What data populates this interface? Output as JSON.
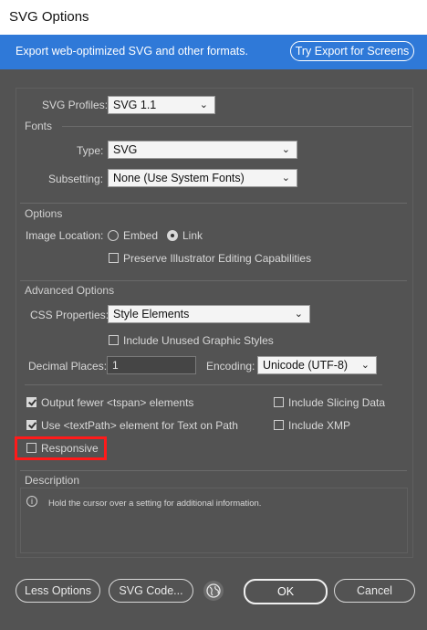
{
  "window": {
    "title": "SVG Options"
  },
  "banner": {
    "message": "Export web-optimized SVG and other formats.",
    "button_label": "Try Export for Screens"
  },
  "svg_profiles": {
    "label": "SVG Profiles:",
    "value": "SVG 1.1"
  },
  "fonts": {
    "section": "Fonts",
    "type_label": "Type:",
    "type_value": "SVG",
    "subsetting_label": "Subsetting:",
    "subsetting_value": "None (Use System Fonts)"
  },
  "options": {
    "section": "Options",
    "image_location_label": "Image Location:",
    "embed_label": "Embed",
    "link_label": "Link",
    "image_location_selected": "Link",
    "preserve_label": "Preserve Illustrator Editing Capabilities",
    "preserve_checked": false
  },
  "advanced": {
    "section": "Advanced Options",
    "css_label": "CSS Properties:",
    "css_value": "Style Elements",
    "include_unused_label": "Include Unused Graphic Styles",
    "include_unused_checked": false,
    "decimal_label": "Decimal Places:",
    "decimal_value": "1",
    "encoding_label": "Encoding:",
    "encoding_value": "Unicode (UTF-8)",
    "output_fewer_label": "Output fewer <tspan> elements",
    "output_fewer_checked": true,
    "textpath_label": "Use <textPath> element for Text on Path",
    "textpath_checked": true,
    "slicing_label": "Include Slicing Data",
    "slicing_checked": false,
    "xmp_label": "Include XMP",
    "xmp_checked": false,
    "responsive_label": "Responsive",
    "responsive_checked": false
  },
  "description": {
    "section": "Description",
    "text": "Hold the cursor over a setting for additional information."
  },
  "footer": {
    "less_options": "Less Options",
    "svg_code": "SVG Code...",
    "ok": "OK",
    "cancel": "Cancel"
  },
  "colors": {
    "background": "#535353",
    "banner": "#2f79d8",
    "highlight": "#ff1a1a"
  }
}
